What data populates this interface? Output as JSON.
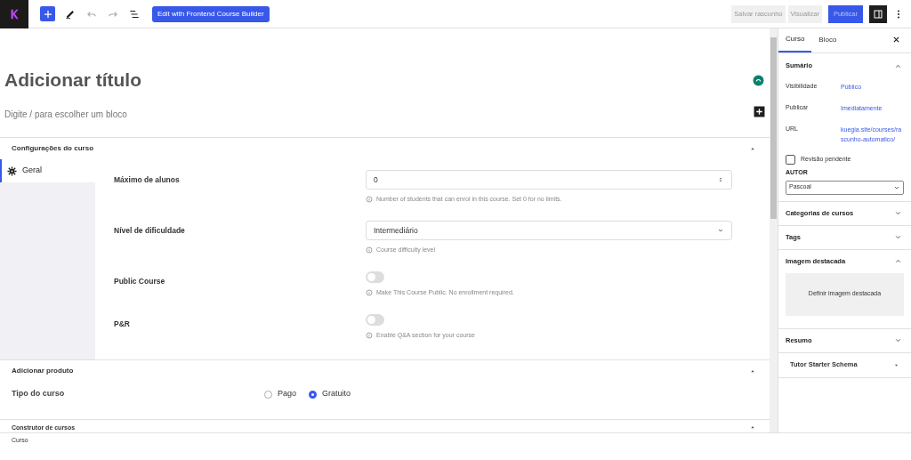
{
  "toolbar": {
    "builder_button": "Edit with Frontend Course Builder",
    "save_draft": "Salvar rascunho",
    "preview": "Visualizar",
    "publish": "Publicar"
  },
  "editor": {
    "title_placeholder": "Adicionar título",
    "block_placeholder": "Digite / para escolher um bloco"
  },
  "course_settings": {
    "title": "Configurações do curso",
    "expanded": true,
    "tabs": [
      {
        "label": "Geral",
        "selected": true
      }
    ],
    "fields": [
      {
        "kind": "number",
        "label": "Máximo de alunos",
        "value": "0",
        "help": "Number of students that can enrol in this course. Set 0 for no limits."
      },
      {
        "kind": "select",
        "label": "Nível de dificuldade",
        "value": "Intermediário",
        "help": "Course difficulty level"
      },
      {
        "kind": "toggle",
        "label": "Public Course",
        "on": false,
        "help": "Make This Course Public. No enrollment required."
      },
      {
        "kind": "toggle",
        "label": "P&R",
        "on": false,
        "help": "Enable Q&A section for your course"
      }
    ]
  },
  "add_product": {
    "title": "Adicionar produto",
    "expanded": true,
    "field_label": "Tipo do curso",
    "options": [
      {
        "label": "Pago",
        "selected": false
      },
      {
        "label": "Gratuito",
        "selected": true
      }
    ]
  },
  "course_builder": {
    "title": "Construtor de cursos",
    "expanded": true
  },
  "footer": {
    "breadcrumb": "Curso"
  },
  "sidebar": {
    "tabs": [
      {
        "label": "Curso",
        "selected": true
      },
      {
        "label": "Bloco",
        "selected": false
      }
    ],
    "summary": {
      "title": "Sumário",
      "expanded": true,
      "rows": [
        {
          "label": "Visibilidade",
          "value": "Público"
        },
        {
          "label": "Publicar",
          "value": "Imediatamente"
        },
        {
          "label": "URL",
          "value": "kuegia.site/courses/rascunho-automatico/"
        }
      ],
      "pending_review": {
        "label": "Revisão pendente",
        "checked": false
      },
      "author_label": "AUTOR",
      "author": "Pascoal"
    },
    "panels": [
      {
        "title": "Categorias de cursos",
        "expanded": false
      },
      {
        "title": "Tags",
        "expanded": false
      },
      {
        "title": "Imagem destacada",
        "expanded": true,
        "button": "Definir imagem destacada"
      },
      {
        "title": "Resumo",
        "expanded": false
      }
    ],
    "schema": {
      "title": "Tutor Starter Schema"
    }
  }
}
